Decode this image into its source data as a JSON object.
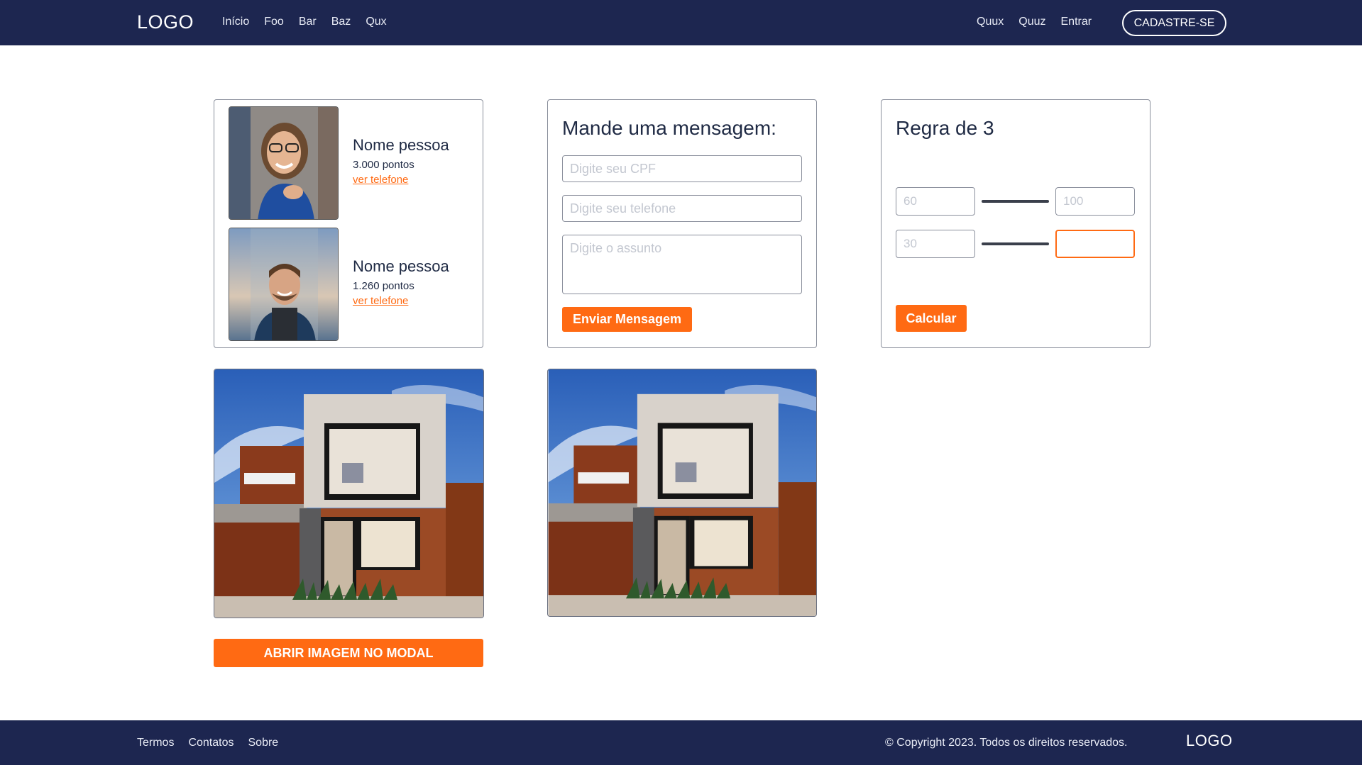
{
  "header": {
    "logo": "LOGO",
    "nav_left": [
      "Início",
      "Foo",
      "Bar",
      "Baz",
      "Qux"
    ],
    "nav_right": [
      "Quux",
      "Quuz",
      "Entrar"
    ],
    "cta": "CADASTRE-SE"
  },
  "people": [
    {
      "name": "Nome pessoa",
      "points": "3.000 pontos",
      "link": "ver telefone"
    },
    {
      "name": "Nome pessoa",
      "points": "1.260 pontos",
      "link": "ver telefone"
    }
  ],
  "message": {
    "title": "Mande uma mensagem:",
    "cpf_placeholder": "Digite seu CPF",
    "phone_placeholder": "Digite seu telefone",
    "subject_placeholder": "Digite o assunto",
    "button": "Enviar Mensagem"
  },
  "rule": {
    "title": "Regra de 3",
    "a_placeholder": "60",
    "b_placeholder": "100",
    "c_placeholder": "30",
    "d_value": "",
    "button": "Calcular"
  },
  "modal_button": "ABRIR IMAGEM NO MODAL",
  "footer": {
    "links": [
      "Termos",
      "Contatos",
      "Sobre"
    ],
    "copyright": "© Copyright 2023. Todos os direitos reservados.",
    "logo": "LOGO"
  },
  "colors": {
    "navy": "#1d2650",
    "accent": "#ff6a13"
  }
}
